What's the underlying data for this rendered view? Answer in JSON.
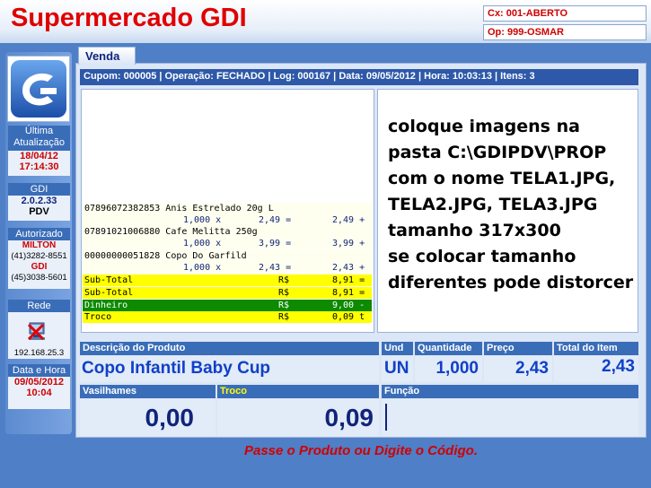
{
  "header": {
    "title": "Supermercado GDI",
    "cx_status": "Cx: 001-ABERTO",
    "op_status": "Op: 999-OSMAR"
  },
  "sidebar": {
    "last_update_label": "Última Atualização",
    "last_update_date": "18/04/12",
    "last_update_time": "17:14:30",
    "gdi_label": "GDI",
    "gdi_version": "2.0.2.33",
    "gdi_sub": "PDV",
    "authorized_label": "Autorizado",
    "auth_name1": "MILTON",
    "auth_phone1": "(41)3282-8551",
    "auth_name2": "GDI",
    "auth_phone2": "(45)3038-5601",
    "network_label": "Rede",
    "network_ip": "192.168.25.3",
    "datetime_label": "Data e Hora",
    "date": "09/05/2012",
    "time": "10:04"
  },
  "tab": {
    "label": "Venda"
  },
  "info_bar": "Cupom: 000005 | Operação: FECHADO | Log: 000167 | Data: 09/05/2012 | Hora: 10:03:13 | Itens: 3",
  "receipt": {
    "items": [
      {
        "code_desc": "07896072382853 Anis Estrelado 20g L",
        "qty": "1,000 x",
        "price": "2,49 =",
        "total": "2,49 +"
      },
      {
        "code_desc": "07891021006880 Cafe Melitta 250g",
        "qty": "1,000 x",
        "price": "3,99 =",
        "total": "3,99 +"
      },
      {
        "code_desc": "00000000051828 Copo Do Garfild",
        "qty": "1,000 x",
        "price": "2,43 =",
        "total": "2,43 +"
      }
    ],
    "summary": [
      {
        "label": "Sub-Total",
        "cur": "R$",
        "value": "8,91 ="
      },
      {
        "label": "Sub-Total",
        "cur": "R$",
        "value": "8,91 ="
      },
      {
        "label": "Dinheiro",
        "cur": "R$",
        "value": "9,00 -"
      },
      {
        "label": "Troco",
        "cur": "R$",
        "value": "0,09 t"
      }
    ]
  },
  "image_message": [
    "coloque imagens na",
    "pasta C:\\GDIPDV\\PROP",
    "com o nome TELA1.JPG,",
    "TELA2.JPG, TELA3.JPG",
    "tamanho 317x300",
    "se colocar tamanho",
    "diferentes pode distorcer"
  ],
  "fields": {
    "desc_label": "Descrição do Produto",
    "desc_value": "Copo Infantil Baby Cup",
    "und_label": "Und",
    "und_value": "UN",
    "qty_label": "Quantidade",
    "qty_value": "1,000",
    "price_label": "Preço",
    "price_value": "2,43",
    "total_label": "Total do Item",
    "total_value": "2,43",
    "vasilhames_label": "Vasilhames",
    "vasilhames_value": "0,00",
    "troco_label": "Troco",
    "troco_value": "0,09",
    "funcao_label": "Função",
    "funcao_value": ""
  },
  "status_message": "Passe o Produto ou Digite o Código.",
  "colors": {
    "accent_red": "#d00000",
    "brand_blue": "#2e58a8",
    "money_green": "#0c8a00",
    "highlight_yellow": "#ffff00"
  }
}
